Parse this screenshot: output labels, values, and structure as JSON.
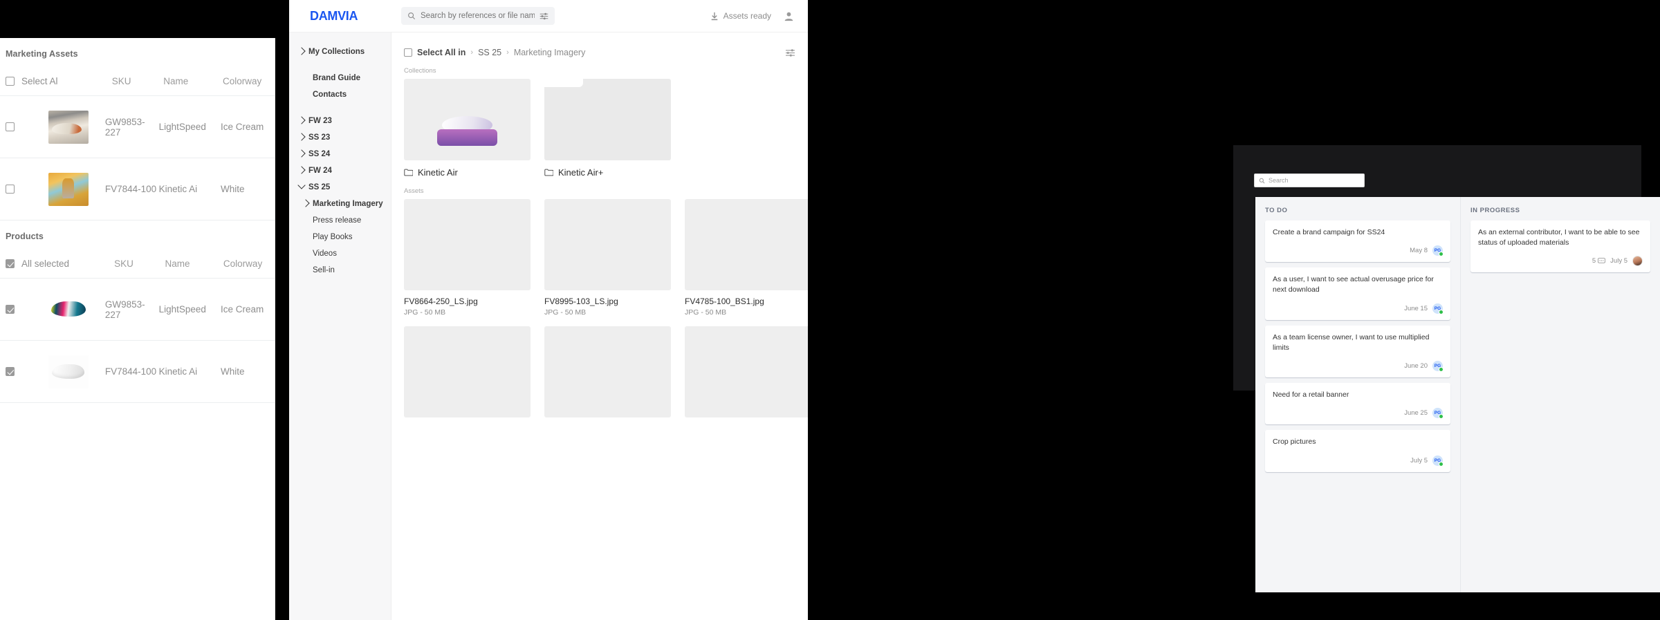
{
  "left_panel": {
    "sections": [
      {
        "title": "Marketing Assets",
        "header": {
          "select_label": "Select Al",
          "sku": "SKU",
          "name": "Name",
          "colorway": "Colorway"
        },
        "all_checked": false,
        "rows": [
          {
            "checked": false,
            "thumb": "th-shoe-beige",
            "sku": "GW9853-227",
            "name": "LightSpeed",
            "colorway": "Ice Cream"
          },
          {
            "checked": false,
            "thumb": "th-yellow",
            "sku": "FV7844-100",
            "name": "Kinetic Ai",
            "colorway": "White"
          }
        ]
      },
      {
        "title": "Products",
        "header": {
          "select_label": "All selected",
          "sku": "SKU",
          "name": "Name",
          "colorway": "Colorway"
        },
        "all_checked": true,
        "rows": [
          {
            "checked": true,
            "thumb": "th-multi",
            "sku": "GW9853-227",
            "name": "LightSpeed",
            "colorway": "Ice Cream"
          },
          {
            "checked": true,
            "thumb": "th-white",
            "sku": "FV7844-100",
            "name": "Kinetic Ai",
            "colorway": "White"
          }
        ]
      }
    ]
  },
  "damvia": {
    "logo": "DAMVIA",
    "search": {
      "placeholder": "Search by references or file names",
      "value": ""
    },
    "header_right": {
      "assets_ready": "Assets ready"
    },
    "sidebar": {
      "items": [
        {
          "label": "My Collections",
          "chevron": "right",
          "bold": true,
          "indent": 0
        },
        {
          "label": "Brand Guide",
          "chevron": "none",
          "bold": true,
          "indent": 1
        },
        {
          "label": "Contacts",
          "chevron": "none",
          "bold": true,
          "indent": 1
        },
        {
          "label": "FW 23",
          "chevron": "right",
          "bold": true,
          "indent": 0
        },
        {
          "label": "SS 23",
          "chevron": "right",
          "bold": true,
          "indent": 0
        },
        {
          "label": "SS 24",
          "chevron": "right",
          "bold": true,
          "indent": 0
        },
        {
          "label": "FW 24",
          "chevron": "right",
          "bold": true,
          "indent": 0
        },
        {
          "label": "SS 25",
          "chevron": "down",
          "bold": true,
          "indent": 0
        },
        {
          "label": "Marketing Imagery",
          "chevron": "right",
          "bold": true,
          "indent": 1
        },
        {
          "label": "Press release",
          "chevron": "none",
          "bold": false,
          "indent": 1
        },
        {
          "label": "Play Books",
          "chevron": "none",
          "bold": false,
          "indent": 1
        },
        {
          "label": "Videos",
          "chevron": "none",
          "bold": false,
          "indent": 1
        },
        {
          "label": "Sell-in",
          "chevron": "none",
          "bold": false,
          "indent": 1
        }
      ]
    },
    "breadcrumb": {
      "select_all": "Select All in",
      "sep": "›",
      "crumb1": "SS 25",
      "crumb2": "Marketing Imagery"
    },
    "groups": {
      "collections": "Collections",
      "assets": "Assets"
    },
    "collections": [
      {
        "label": "Kinetic Air",
        "thumb": "img-kinetic"
      },
      {
        "label": "Kinetic Air+",
        "thumb": "placeholder"
      }
    ],
    "assets_row1": [
      {
        "name": "FV8664-250_LS.jpg",
        "meta": "JPG - 50 MB",
        "thumb": "ph-a"
      },
      {
        "name": "FV8995-103_LS.jpg",
        "meta": "JPG - 50 MB",
        "thumb": "ph-b"
      },
      {
        "name": "FV4785-100_BS1.jpg",
        "meta": "JPG - 50 MB",
        "thumb": "ph-c"
      }
    ],
    "assets_row2": [
      {
        "thumb": "ph-d"
      },
      {
        "thumb": "ph-e"
      },
      {
        "thumb": "ph-f"
      }
    ]
  },
  "kanban": {
    "search": {
      "placeholder": "Search",
      "value": ""
    },
    "columns": [
      {
        "title": "TO DO",
        "cards": [
          {
            "text": "Create a brand campaign for SS24",
            "date": "May 8",
            "avatar": "PG",
            "comments": null
          },
          {
            "text": "As a user, I want to see actual overusage price for next download",
            "date": "June 15",
            "avatar": "PG",
            "comments": null
          },
          {
            "text": "As a team license owner, I want to use multiplied limits",
            "date": "June 20",
            "avatar": "PG",
            "comments": null
          },
          {
            "text": "Need for a retail banner",
            "date": "June 25",
            "avatar": "PG",
            "comments": null
          },
          {
            "text": "Crop pictures",
            "date": "July 5",
            "avatar": "PG",
            "comments": null
          }
        ]
      },
      {
        "title": "IN PROGRESS",
        "cards": [
          {
            "text": "As an external contributor, I want to be able to see status of uploaded materials",
            "date": "July 5",
            "avatar": "photo",
            "comments": "5"
          }
        ]
      }
    ]
  },
  "colors": {
    "brand_blue": "#1a56f0",
    "green_status": "#2fbf4a",
    "panel_bg": "#f4f5f7"
  }
}
